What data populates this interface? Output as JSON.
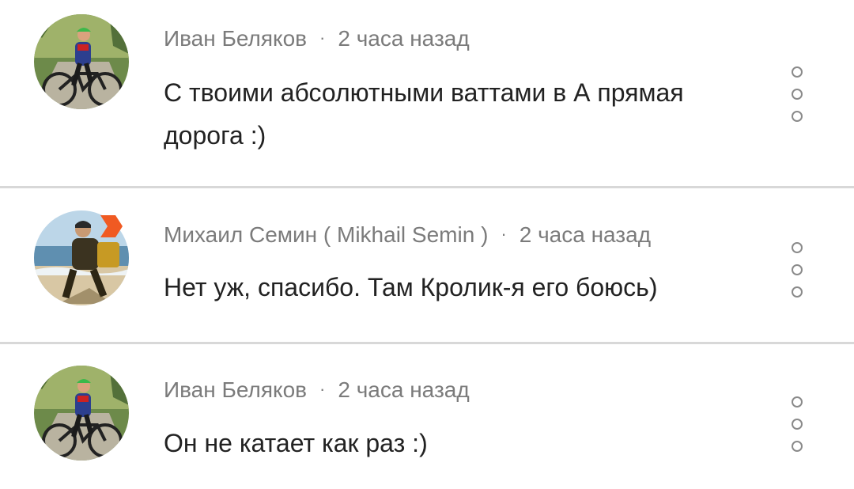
{
  "comments": [
    {
      "author": "Иван Беляков",
      "time": "2 часа назад",
      "text": "С твоими абсолютными ваттами в А прямая дорога :)",
      "avatar_icon": "cyclist-avatar"
    },
    {
      "author": "Михаил Семин ( Mikhail Semin )",
      "time": "2 часа назад",
      "text": "Нет уж, спасибо. Там Кролик-я его боюсь)",
      "avatar_icon": "beach-runner-avatar",
      "badge_icon": "play-badge-icon",
      "badge_color": "#f05a22"
    },
    {
      "author": "Иван Беляков",
      "time": "2 часа назад",
      "text": "Он не катает как раз :)",
      "avatar_icon": "cyclist-avatar"
    }
  ],
  "separator": "·",
  "more_icon": "more-vertical-icon"
}
